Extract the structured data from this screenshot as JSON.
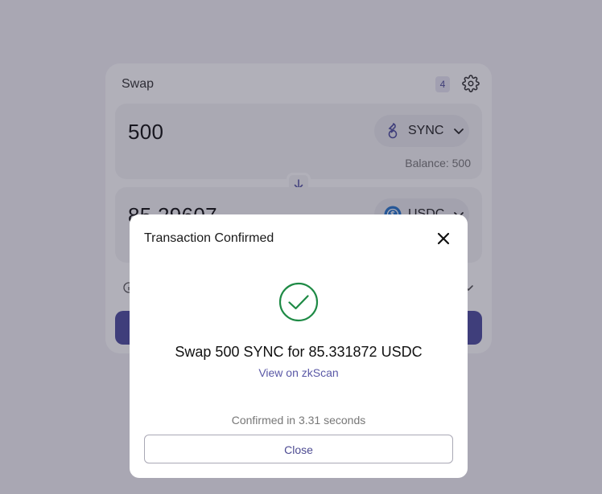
{
  "swap": {
    "title": "Swap",
    "pending_count": "4",
    "from": {
      "amount": "500",
      "token": "SYNC",
      "balance": "Balance: 500"
    },
    "to": {
      "amount": "85.29607",
      "token": "USDC"
    }
  },
  "modal": {
    "title": "Transaction Confirmed",
    "summary": "Swap 500 SYNC for 85.331872 USDC",
    "link_label": "View on zkScan",
    "confirmed_text": "Confirmed in 3.31 seconds",
    "close_label": "Close"
  },
  "icons": {
    "settings": "gear-icon",
    "sync": "sync-token-icon",
    "usdc": "usdc-token-icon",
    "success": "check-circle-icon",
    "close": "close-icon"
  },
  "colors": {
    "accent": "#4d4d9e",
    "success": "#1e8a45",
    "link": "#5a58a6"
  }
}
